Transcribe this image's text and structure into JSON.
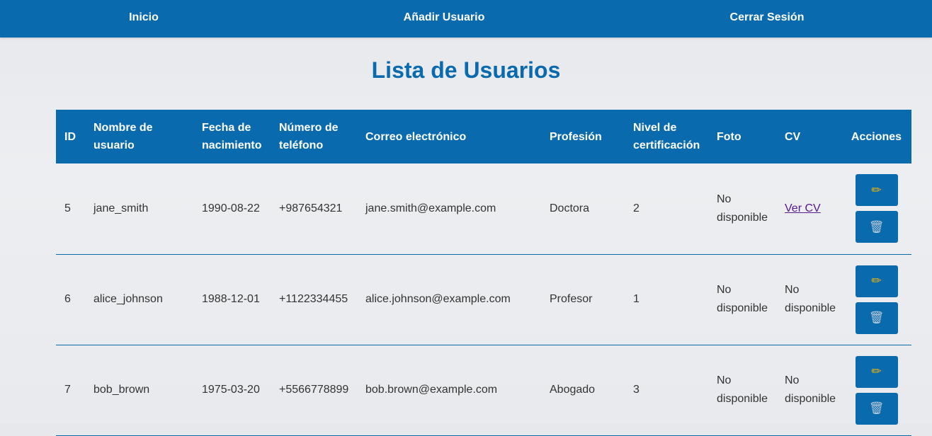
{
  "nav": {
    "inicio": "Inicio",
    "add_user": "Añadir Usuario",
    "logout": "Cerrar Sesión"
  },
  "page": {
    "title": "Lista de Usuarios"
  },
  "table": {
    "headers": [
      "ID",
      "Nombre de usuario",
      "Fecha de nacimiento",
      "Número de teléfono",
      "Correo electrónico",
      "Profesión",
      "Nivel de certificación",
      "Foto",
      "CV",
      "Acciones"
    ],
    "rows": [
      {
        "id": "5",
        "username": "jane_smith",
        "birthdate": "1990-08-22",
        "phone": "+987654321",
        "email": "jane.smith@example.com",
        "profession": "Doctora",
        "level": "2",
        "photo": "No disponible",
        "cv": "Ver CV"
      },
      {
        "id": "6",
        "username": "alice_johnson",
        "birthdate": "1988-12-01",
        "phone": "+1122334455",
        "email": "alice.johnson@example.com",
        "profession": "Profesor",
        "level": "1",
        "photo": "No disponible",
        "cv": "No disponible"
      },
      {
        "id": "7",
        "username": "bob_brown",
        "birthdate": "1975-03-20",
        "phone": "+5566778899",
        "email": "bob.brown@example.com",
        "profession": "Abogado",
        "level": "3",
        "photo": "No disponible",
        "cv": "No disponible"
      }
    ]
  },
  "icons": {
    "edit": "pencil-icon",
    "delete": "trash-icon",
    "edit_glyph": "✏",
    "delete_glyph": "🗑"
  },
  "colors": {
    "primary": "#0a6aae",
    "background": "#e9ebee",
    "text": "#333333",
    "visited_link": "#551a8b"
  }
}
